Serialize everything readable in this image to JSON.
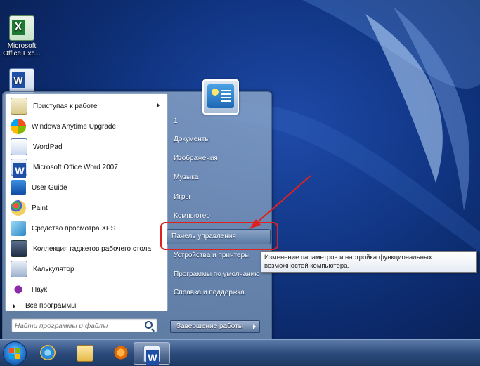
{
  "desktop": {
    "icons": [
      {
        "label": "Microsoft Office Exc..."
      },
      {
        "label": "Microsoft Office Word"
      }
    ]
  },
  "start_menu": {
    "programs": [
      {
        "label": "Приступая к работе",
        "has_submenu": true,
        "icon": "getting-started-icon"
      },
      {
        "label": "Windows Anytime Upgrade",
        "icon": "windows-flag-icon"
      },
      {
        "label": "WordPad",
        "icon": "wordpad-icon"
      },
      {
        "label": "Microsoft Office Word 2007",
        "icon": "word-icon"
      },
      {
        "label": "User Guide",
        "icon": "user-guide-icon"
      },
      {
        "label": "Paint",
        "icon": "paint-icon"
      },
      {
        "label": "Средство просмотра XPS",
        "icon": "xps-viewer-icon"
      },
      {
        "label": "Коллекция гаджетов рабочего стола",
        "icon": "gadgets-icon"
      },
      {
        "label": "Калькулятор",
        "icon": "calculator-icon"
      },
      {
        "label": "Паук",
        "icon": "spider-solitaire-icon"
      }
    ],
    "all_programs": "Все программы",
    "search_placeholder": "Найти программы и файлы",
    "right": {
      "user": "1",
      "documents": "Документы",
      "pictures": "Изображения",
      "music": "Музыка",
      "games": "Игры",
      "computer": "Компьютер",
      "control_panel": "Панель управления",
      "devices": "Устройства и принтеры",
      "default_programs": "Программы по умолчанию",
      "help": "Справка и поддержка"
    },
    "shutdown_label": "Завершение работы"
  },
  "tooltip": "Изменение параметров и настройка функциональных возможностей компьютера.",
  "annotation_color": "#e0201c",
  "taskbar": {
    "items": [
      "start-orb",
      "internet-explorer-icon",
      "explorer-icon",
      "media-player-icon",
      "word-icon"
    ]
  }
}
